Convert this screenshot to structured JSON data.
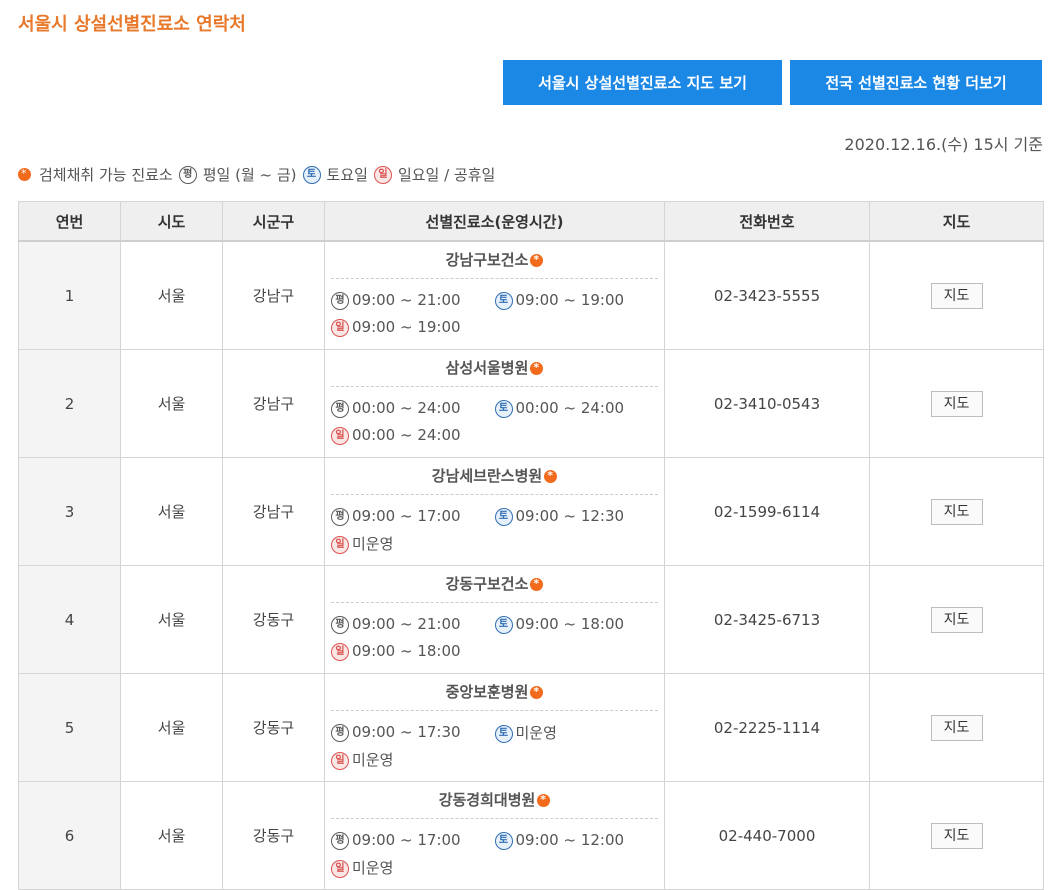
{
  "page": {
    "title": "서울시 상설선별진료소 연락처",
    "buttons": {
      "map_view": "서울시 상설선별진료소 지도 보기",
      "nationwide_more": "전국 선별진료소 현황 더보기"
    },
    "date_basis": "2020.12.16.(수) 15시 기준"
  },
  "legend": {
    "specimen_label": "검체채취 가능 진료소",
    "weekday_badge": "평",
    "weekday_label": "평일 (월 ~ 금)",
    "saturday_badge": "토",
    "saturday_label": "토요일",
    "sunday_badge": "일",
    "sunday_label": "일요일 / 공휴일"
  },
  "table": {
    "headers": [
      "연번",
      "시도",
      "시군구",
      "선별진료소(운영시간)",
      "전화번호",
      "지도"
    ],
    "map_label": "지도",
    "rows": [
      {
        "no": "1",
        "sido": "서울",
        "sigungu": "강남구",
        "name": "강남구보건소",
        "weekday": "09:00 ~ 21:00",
        "saturday": "09:00 ~ 19:00",
        "sunday": "09:00 ~ 19:00",
        "phone": "02-3423-5555"
      },
      {
        "no": "2",
        "sido": "서울",
        "sigungu": "강남구",
        "name": "삼성서울병원",
        "weekday": "00:00 ~ 24:00",
        "saturday": "00:00 ~ 24:00",
        "sunday": "00:00 ~ 24:00",
        "phone": "02-3410-0543"
      },
      {
        "no": "3",
        "sido": "서울",
        "sigungu": "강남구",
        "name": "강남세브란스병원",
        "weekday": "09:00 ~ 17:00",
        "saturday": "09:00 ~ 12:30",
        "sunday": "미운영",
        "phone": "02-1599-6114"
      },
      {
        "no": "4",
        "sido": "서울",
        "sigungu": "강동구",
        "name": "강동구보건소",
        "weekday": "09:00 ~ 21:00",
        "saturday": "09:00 ~ 18:00",
        "sunday": "09:00 ~ 18:00",
        "phone": "02-3425-6713"
      },
      {
        "no": "5",
        "sido": "서울",
        "sigungu": "강동구",
        "name": "중앙보훈병원",
        "weekday": "09:00 ~ 17:30",
        "saturday": "미운영",
        "sunday": "미운영",
        "phone": "02-2225-1114"
      },
      {
        "no": "6",
        "sido": "서울",
        "sigungu": "강동구",
        "name": "강동경희대병원",
        "weekday": "09:00 ~ 17:00",
        "saturday": "09:00 ~ 12:00",
        "sunday": "미운영",
        "phone": "02-440-7000"
      }
    ]
  }
}
